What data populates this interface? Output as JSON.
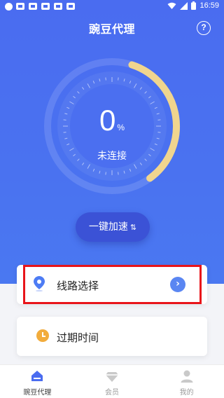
{
  "status_bar": {
    "time": "16:59",
    "notification_icons": [
      "app-icon",
      "app-icon",
      "app-icon",
      "app-icon",
      "app-icon"
    ],
    "system_icons": [
      "wifi-icon",
      "signal-icon",
      "battery-icon"
    ]
  },
  "header": {
    "title": "豌豆代理",
    "help_label": "?"
  },
  "gauge": {
    "percent": "0",
    "percent_unit": "%",
    "status": "未连接",
    "progress_fraction": 0.35
  },
  "speed_button": {
    "label": "一键加速",
    "icon": "swap-arrows-icon"
  },
  "cards": {
    "route": {
      "label": "线路选择",
      "icon": "location-pin-icon"
    },
    "expire": {
      "label": "过期时间",
      "icon": "clock-icon"
    }
  },
  "tabbar": {
    "items": [
      {
        "label": "豌豆代理",
        "icon": "home-icon",
        "active": true
      },
      {
        "label": "会员",
        "icon": "diamond-icon",
        "active": false
      },
      {
        "label": "我的",
        "icon": "user-icon",
        "active": false
      }
    ]
  },
  "colors": {
    "primary": "#4a6cf0",
    "button": "#3b52d6",
    "gauge_progress": "#f0d58e",
    "highlight": "#e8141a",
    "clock": "#f2ac3c"
  }
}
